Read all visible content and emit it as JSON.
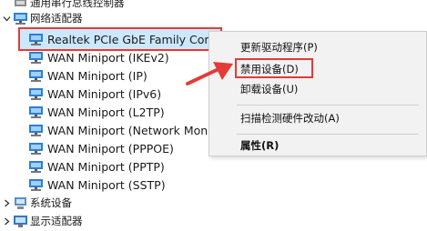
{
  "device_tree": {
    "top_partial_label": "通用串行总线控制器",
    "category_expanded": {
      "label": "网络适配器",
      "expanded": true
    },
    "devices": [
      {
        "label": "Realtek PCIe GbE Family Controller",
        "selected": true
      },
      {
        "label": "WAN Miniport (IKEv2)"
      },
      {
        "label": "WAN Miniport (IP)"
      },
      {
        "label": "WAN Miniport (IPv6)"
      },
      {
        "label": "WAN Miniport (L2TP)"
      },
      {
        "label": "WAN Miniport (Network Monitor)"
      },
      {
        "label": "WAN Miniport (PPPOE)"
      },
      {
        "label": "WAN Miniport (PPTP)"
      },
      {
        "label": "WAN Miniport (SSTP)"
      }
    ],
    "category_collapsed_1": {
      "label": "系统设备"
    },
    "category_collapsed_2": {
      "label": "显示适配器"
    }
  },
  "context_menu": {
    "items": [
      {
        "label": "更新驱动程序(P)"
      },
      {
        "label": "禁用设备(D)",
        "highlighted": true
      },
      {
        "label": "卸载设备(U)"
      },
      {
        "label": "扫描检测硬件改动(A)"
      },
      {
        "label": "属性(R)",
        "bold": true
      }
    ]
  },
  "colors": {
    "annotation_red": "#e33b36",
    "selection_bg": "#cce8ff",
    "menu_bg": "#f2f2f2"
  },
  "icons": {
    "network_adapter": "network-adapter-icon",
    "category": "network-category-icon",
    "system": "system-devices-icon",
    "display": "display-adapter-icon"
  }
}
